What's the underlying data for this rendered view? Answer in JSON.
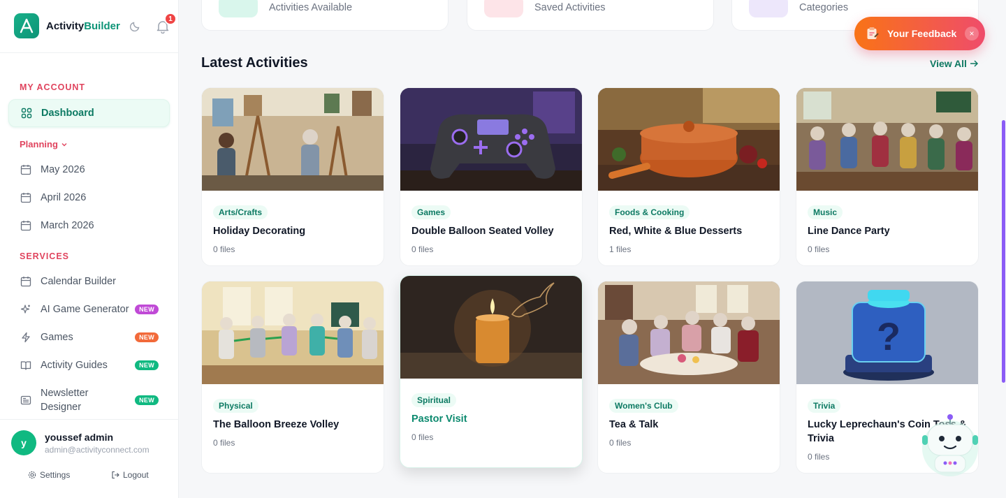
{
  "brand": {
    "name_prefix": "Activity",
    "name_suffix": "Builder"
  },
  "notifications": {
    "count": "1"
  },
  "sidebar": {
    "my_account_label": "MY ACCOUNT",
    "dashboard_label": "Dashboard",
    "planning_label": "Planning",
    "planning_items": [
      "May 2026",
      "April 2026",
      "March 2026"
    ],
    "services_label": "SERVICES",
    "services": [
      {
        "label": "Calendar Builder",
        "badge": ""
      },
      {
        "label": "AI Game Generator",
        "badge": "NEW",
        "badge_color": "#c04ad6"
      },
      {
        "label": "Games",
        "badge": "NEW",
        "badge_color": "#f26a3a"
      },
      {
        "label": "Activity Guides",
        "badge": "NEW",
        "badge_color": "#10b981"
      },
      {
        "label": "Newsletter",
        "label2": "Designer",
        "badge": "NEW",
        "badge_color": "#10b981"
      }
    ]
  },
  "user": {
    "initial": "y",
    "name": "youssef admin",
    "email": "admin@activityconnect.com",
    "settings_label": "Settings",
    "logout_label": "Logout"
  },
  "stats": [
    {
      "label": "Activities Available",
      "icon_color": "#d9f6ec"
    },
    {
      "label": "Saved Activities",
      "icon_color": "#fde4e8"
    },
    {
      "label": "Categories",
      "icon_color": "#ede7fb"
    }
  ],
  "latest": {
    "title": "Latest Activities",
    "view_all_label": "View All",
    "cards": [
      {
        "category": "Arts/Crafts",
        "title": "Holiday Decorating",
        "files": "0 files"
      },
      {
        "category": "Games",
        "title": "Double Balloon Seated Volley",
        "files": "0 files"
      },
      {
        "category": "Foods & Cooking",
        "title": "Red, White & Blue Desserts",
        "files": "1 files"
      },
      {
        "category": "Music",
        "title": "Line Dance Party",
        "files": "0 files"
      },
      {
        "category": "Physical",
        "title": "The Balloon Breeze Volley",
        "files": "0 files"
      },
      {
        "category": "Spiritual",
        "title": "Pastor Visit",
        "files": "0 files"
      },
      {
        "category": "Women's Club",
        "title": "Tea & Talk",
        "files": "0 files"
      },
      {
        "category": "Trivia",
        "title": "Lucky Leprechaun's Coin Toss & Trivia",
        "files": "0 files"
      }
    ]
  },
  "feedback": {
    "label": "Your Feedback",
    "close": "×"
  }
}
